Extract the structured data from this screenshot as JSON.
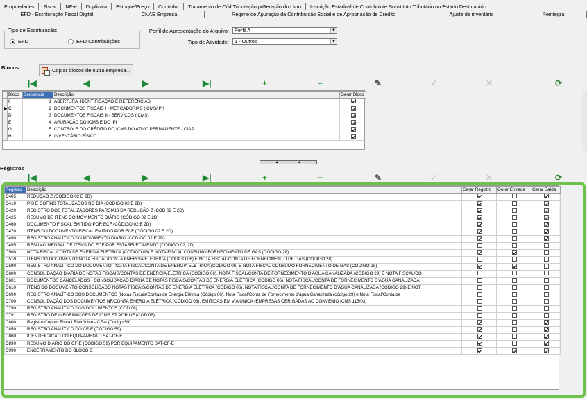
{
  "tabs_row1": [
    "Propriedades",
    "Fiscal",
    "NF-e",
    "Duplicata",
    "Estoque/Preço",
    "Contador",
    "Tratamento de Cód.Tributação p/Geração do Livro",
    "Inscrição Estadual de Contribuinte Substituto Tributário no Estado Destinatário"
  ],
  "tabs_row2": [
    "EFD - Escrituração Fiscal Digital",
    "CNAE Empresa",
    "Regime de Apuração da Contribuição Social e de Apropriação de Crédito",
    "Ajuste de inventário",
    "Reintegra"
  ],
  "tipo_escrituracao": {
    "legend": "Tipo de Escrituração:",
    "options": [
      {
        "label": "EFD",
        "selected": true
      },
      {
        "label": "EFD Contribuições",
        "selected": false
      }
    ]
  },
  "perfil": {
    "label": "Perfil de Apresentação do Arquivo:",
    "value": "Perfil A"
  },
  "atividade": {
    "label": "Tipo de Atividade:",
    "value": "1 - Outros"
  },
  "blocos": {
    "title": "Blocos",
    "copy_button": "Copiar blocos de outra empresa...",
    "columns": [
      "Bloco",
      "Sequência",
      "Descrição",
      "Gerar Bloco"
    ],
    "rows": [
      {
        "bloco": "0",
        "seq": "1",
        "desc": "ABERTURA, IDENTIFICAÇÃO E REFERÊNCIAS",
        "gerar": true,
        "current": false
      },
      {
        "bloco": "C",
        "seq": "2",
        "desc": "DOCUMENTOS FISCAIS I - MERCADORIAS (ICMS/IPI)",
        "gerar": true,
        "current": true
      },
      {
        "bloco": "D",
        "seq": "3",
        "desc": "DOCUMENTOS FISCAIS II - SERVIÇOS (ICMS)",
        "gerar": true,
        "current": false
      },
      {
        "bloco": "E",
        "seq": "4",
        "desc": "APURAÇÃO DO ICMS E DO IPI",
        "gerar": true,
        "current": false
      },
      {
        "bloco": "G",
        "seq": "5",
        "desc": "CONTROLE DO CRÉDITO DO ICMS DO ATIVO PERMANENTE - CIAP",
        "gerar": true,
        "current": false
      },
      {
        "bloco": "H",
        "seq": "6",
        "desc": "INVENTÁRIO FÍSICO",
        "gerar": true,
        "current": false
      }
    ]
  },
  "registros": {
    "title": "Registros",
    "columns": [
      "Registro",
      "Descrição",
      "Gerar Registro",
      "Gerar Entrada",
      "Gerar Saída"
    ],
    "rows": [
      {
        "reg": "C405",
        "desc": "REDUÇÃO Z (CÓDIGO 02 E 2D)",
        "r": true,
        "e": false,
        "s": true
      },
      {
        "reg": "C410",
        "desc": "PIS E COFINS TOTALIZADOS NO DIA (CÓDIGO 02 E 2D)",
        "r": true,
        "e": false,
        "s": true
      },
      {
        "reg": "C420",
        "desc": "REGISTRO DOS TOTALIZADORES PARCIAIS DA REDUÇÃO Z (COD 02 E 2D)",
        "r": true,
        "e": false,
        "s": true
      },
      {
        "reg": "C425",
        "desc": "RESUMO DE ITENS DO MOVIMENTO DIÁRIO (CÓDIGO 02 E 2D)",
        "r": true,
        "e": false,
        "s": true
      },
      {
        "reg": "C460",
        "desc": "DOCUMENTO FISCAL EMITIDO POR ECF (CÓDIGO 02 E 2D)",
        "r": true,
        "e": false,
        "s": true
      },
      {
        "reg": "C470",
        "desc": "ITENS DO DOCUMENTO FISCAL EMITIDO POR ECF (CÓDIGO 02 E 2D)",
        "r": true,
        "e": false,
        "s": true
      },
      {
        "reg": "C490",
        "desc": "REGISTRO ANALÍTICO DO MOVIMENTO DIÁRIO (CÓDIGO 02 E 2D)",
        "r": true,
        "e": false,
        "s": true
      },
      {
        "reg": "C495",
        "desc": "RESUMO MENSAL DE ITENS DO ECF POR ESTABELECIMENTO (CÓDIGO 02, 2D)",
        "r": false,
        "e": false,
        "s": false
      },
      {
        "reg": "C500",
        "desc": "NOTA FISCAL/CONTA DE ENERGIA ELÉTRICA (CÓDIGO 06) E NOTA FISCAL CONSUMO FORNECIMENTO DE GÁS (CÓDIGO 28)",
        "r": true,
        "e": true,
        "s": false
      },
      {
        "reg": "C510",
        "desc": "ITENS DO DOCUMENTO NOTA FISCAL/CONTA ENERGIA ELÉTRICA (CÓDIGO 06) E NOTA FISCAL/CONTA DE FORNECIMENTO DE GÁS (CÓDIGO 28)",
        "r": false,
        "e": false,
        "s": false
      },
      {
        "reg": "C590",
        "desc": "REGISTRO ANALÍTICO DO DOCUMENTO - NOTA FISCAL/CONTA DE ENERGIA ELÉTRICA (CÓDIGO 06) E NOTA FISCAL CONSUMO FORNECIMENTO DE GÁS (CÓDIGO 28)",
        "r": true,
        "e": true,
        "s": false
      },
      {
        "reg": "C600",
        "desc": "CONSOLIDAÇÃO DIÁRIA DE NOTAS FISCAIS/CONTAS DE ENERGIA ELÉTRICA (CÓDIGO 06), NOTA FISCAL/CONTA DE FORNECIMENTO D'ÁGUA CANALIZADA (CÓDIGO 29) E NOTA FISCAL/CO",
        "r": false,
        "e": false,
        "s": false
      },
      {
        "reg": "C601",
        "desc": "DOCUMENTOS CANCELADOS - CONSOLIDAÇÃO DIÁRIA DE NOTAS FISCAIS/CONTAS DE ENERGIA ELÉTRICA (CÓDIGO 06), NOTA FISCAL/CONTA DE FORNECIMENTO D'ÁGUA CANALIZADA",
        "r": false,
        "e": false,
        "s": false
      },
      {
        "reg": "C610",
        "desc": "ITENS DO DOCUMENTO CONSOLIDADO NOTAS FISCAIS/CONTAS DE ENERGIA ELÉTRICA (CÓDIGO 06), NOTA FISCAL/CONTA DE FORNECIMENTO D'ÁGUA CANALIZADA (CÓDIGO 29) E NOT",
        "r": false,
        "e": false,
        "s": false
      },
      {
        "reg": "C690",
        "desc": "REGISTRO ANALÍTICO DOS DOCUMENTOS (Notas Fiscais/Contas de Energia Elétrica (Código 06), Nota Fiscal/Conta de Fornecimento d'água Canalizada (código 29) e Nota Fiscal/Conta de",
        "r": false,
        "e": false,
        "s": false
      },
      {
        "reg": "C700",
        "desc": "CONSOLIDAÇÃO DOS DOCUMENTOS NF/CONTA ENERGIA ELÉTRICA (CÓDIGO 06), EMITIDAS EM VIA ÚNICA (EMPRESAS OBRIGADAS AO CONVENIO ICMS 115/03)",
        "r": false,
        "e": false,
        "s": false
      },
      {
        "reg": "C790",
        "desc": "REGISTRO ANALÍTICO DOS DOCUMENTOS (COD 06)",
        "r": false,
        "e": false,
        "s": false
      },
      {
        "reg": "C791",
        "desc": "REGISTRO DE INFORMAÇÕES DE ICMS ST POR UF (COD 06)",
        "r": false,
        "e": false,
        "s": false
      },
      {
        "reg": "C800",
        "desc": "Registro Cupom Fisca l Eletrônico - CF-e (Código 59)",
        "r": true,
        "e": false,
        "s": true
      },
      {
        "reg": "C850",
        "desc": "REGISTRO ANALÍTICO DO CF-E (CODIGO 59)",
        "r": true,
        "e": false,
        "s": true
      },
      {
        "reg": "C860",
        "desc": "IDENTIFICAÇÃO DO EQUIPAMENTO SAT-CF-E",
        "r": true,
        "e": false,
        "s": true
      },
      {
        "reg": "C890",
        "desc": "RESUMO DIÁRIO DO CF-E (CÓDIGO 59) POR EQUIPAMENTO SAT-CF-E",
        "r": true,
        "e": false,
        "s": true
      },
      {
        "reg": "C990",
        "desc": "ENCERRAMENTO DO BLOCO C",
        "r": true,
        "e": true,
        "s": true
      }
    ]
  },
  "nav_icons": [
    "first-icon",
    "prior-icon",
    "next-icon",
    "last-icon",
    "insert-icon",
    "delete-icon",
    "edit-icon",
    "post-icon",
    "cancel-icon",
    "refresh-icon"
  ],
  "nav_glyphs": [
    "|◀",
    "◀",
    "▶",
    "▶|",
    "+",
    "−",
    "✎",
    "✓",
    "✕",
    "⟳"
  ],
  "colors": {
    "highlight": "#6cc24a",
    "selected_header": "#3d6fb6"
  }
}
